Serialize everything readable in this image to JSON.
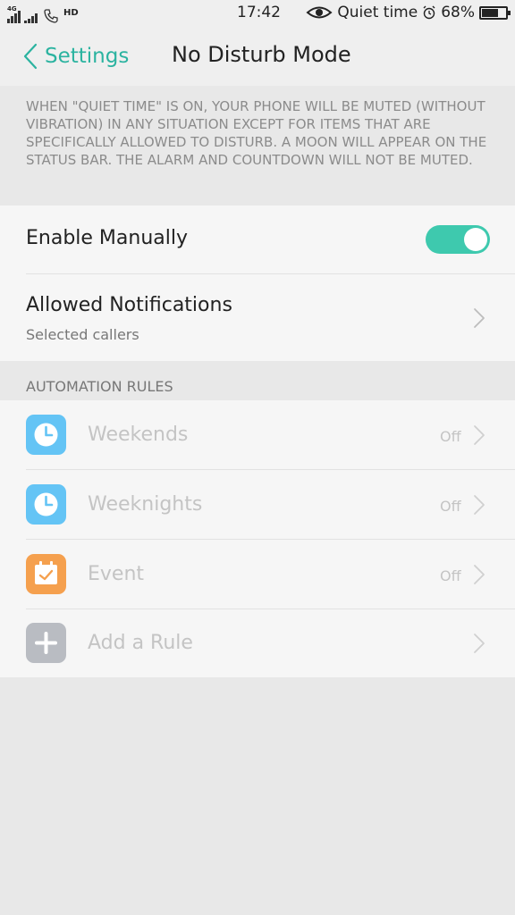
{
  "status_bar": {
    "network": "4G",
    "phone_tag": "HD",
    "time": "17:42",
    "mode": "Quiet time",
    "battery": "68%",
    "battery_level": 0.68
  },
  "header": {
    "back_label": "Settings",
    "title": "No Disturb Mode"
  },
  "description": "When \"Quiet time\" is on, your phone will be muted (without vibration) in any situation except for items that are specifically allowed to disturb. A moon will appear on the status bar. The alarm and countdown will not be muted.",
  "enable_manually": {
    "label": "Enable Manually",
    "enabled": true
  },
  "allowed_notifications": {
    "label": "Allowed Notifications",
    "value": "Selected callers"
  },
  "automation": {
    "section_label": "AUTOMATION RULES",
    "rules": [
      {
        "label": "Weekends",
        "status": "Off",
        "icon": "clock-icon",
        "color": "#64c4f5"
      },
      {
        "label": "Weeknights",
        "status": "Off",
        "icon": "clock-icon",
        "color": "#64c4f5"
      },
      {
        "label": "Event",
        "status": "Off",
        "icon": "calendar-icon",
        "color": "#f5a04e"
      }
    ],
    "add_rule": {
      "label": "Add a Rule",
      "icon": "plus-icon",
      "color": "#b9bcc2"
    }
  },
  "colors": {
    "accent": "#2bb3a0",
    "toggle_on": "#3ec9ae"
  }
}
